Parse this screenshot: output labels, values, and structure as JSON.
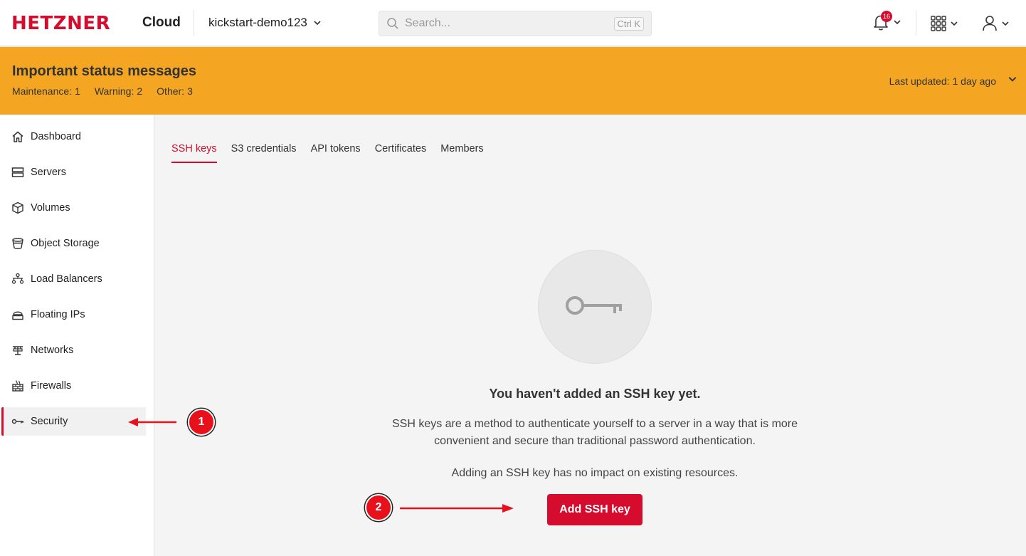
{
  "header": {
    "logo": "HETZNER",
    "product": "Cloud",
    "project": "kickstart-demo123",
    "search": {
      "placeholder": "Search...",
      "shortcut": "Ctrl K"
    },
    "notifications_count": "16"
  },
  "status_banner": {
    "title": "Important status messages",
    "counts": [
      {
        "label": "Maintenance:",
        "value": "1"
      },
      {
        "label": "Warning:",
        "value": "2"
      },
      {
        "label": "Other:",
        "value": "3"
      }
    ],
    "last_updated_label": "Last updated:",
    "last_updated_value": "1 day ago"
  },
  "sidebar": {
    "items": [
      {
        "label": "Dashboard",
        "icon": "home-icon"
      },
      {
        "label": "Servers",
        "icon": "server-icon"
      },
      {
        "label": "Volumes",
        "icon": "cube-icon"
      },
      {
        "label": "Object Storage",
        "icon": "bucket-icon"
      },
      {
        "label": "Load Balancers",
        "icon": "load-balancer-icon"
      },
      {
        "label": "Floating IPs",
        "icon": "floating-ip-icon"
      },
      {
        "label": "Networks",
        "icon": "network-icon"
      },
      {
        "label": "Firewalls",
        "icon": "firewall-icon"
      },
      {
        "label": "Security",
        "icon": "key-icon",
        "active": true
      }
    ]
  },
  "tabs": [
    {
      "label": "SSH keys",
      "active": true
    },
    {
      "label": "S3 credentials"
    },
    {
      "label": "API tokens"
    },
    {
      "label": "Certificates"
    },
    {
      "label": "Members"
    }
  ],
  "empty_state": {
    "title": "You haven't added an SSH key yet.",
    "description": "SSH keys are a method to authenticate yourself to a server in a way that is more convenient and secure than traditional password authentication.",
    "note": "Adding an SSH key has no impact on existing resources.",
    "button": "Add SSH key"
  },
  "annotations": {
    "step1": "1",
    "step2": "2"
  },
  "colors": {
    "accent": "#d50c2d",
    "banner": "#f4a622",
    "marker": "#e8101a"
  }
}
